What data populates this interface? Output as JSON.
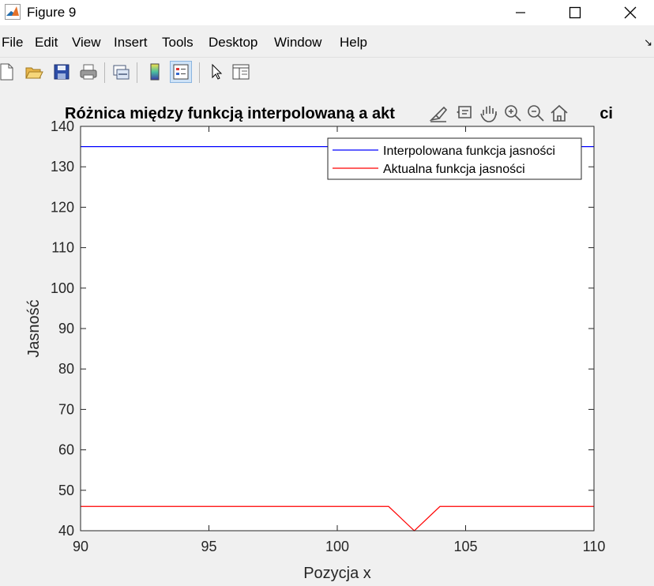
{
  "window": {
    "title": "Figure 9"
  },
  "menu": {
    "items": [
      "File",
      "Edit",
      "View",
      "Insert",
      "Tools",
      "Desktop",
      "Window",
      "Help"
    ]
  },
  "toolbar": {
    "buttons": [
      "new-figure-icon",
      "open-file-icon",
      "save-icon",
      "print-icon",
      "link-plot-icon",
      "colorbar-icon",
      "legend-icon",
      "pointer-icon",
      "property-inspector-icon"
    ]
  },
  "axes_toolbar": {
    "buttons": [
      "brush-icon",
      "data-tips-icon",
      "pan-icon",
      "zoom-in-icon",
      "zoom-out-icon",
      "restore-view-icon"
    ]
  },
  "chart_data": {
    "type": "line",
    "title": "Różnica między funkcją interpolowaną a aktualną funkcją jasności",
    "title_visible_left": "Różnica między funkcją interpolowaną a akt",
    "title_visible_right": "ci",
    "xlabel": "Pozycja x",
    "ylabel": "Jasność",
    "xlim": [
      90,
      110
    ],
    "ylim": [
      40,
      140
    ],
    "xticks": [
      90,
      95,
      100,
      105,
      110
    ],
    "yticks": [
      40,
      50,
      60,
      70,
      80,
      90,
      100,
      110,
      120,
      130,
      140
    ],
    "grid": false,
    "legend_position": "top-right",
    "series": [
      {
        "name": "Interpolowana funkcja jasności",
        "color": "#0000ff",
        "x": [
          90,
          110
        ],
        "y": [
          135,
          135
        ]
      },
      {
        "name": "Aktualna funkcja jasności",
        "color": "#ff0000",
        "x": [
          90,
          102,
          103,
          104,
          110
        ],
        "y": [
          46,
          46,
          40,
          46,
          46
        ]
      }
    ]
  }
}
